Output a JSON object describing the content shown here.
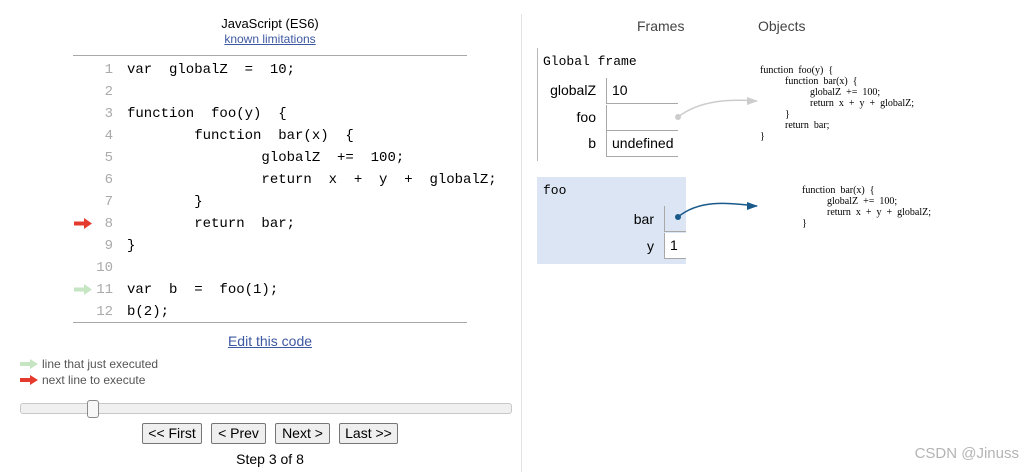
{
  "header": {
    "lang": "JavaScript (ES6)",
    "limitations_link": "known limitations"
  },
  "code": {
    "lines": [
      {
        "num": "1",
        "text": "var  globalZ  =  10;"
      },
      {
        "num": "2",
        "text": ""
      },
      {
        "num": "3",
        "text": "function  foo(y)  {"
      },
      {
        "num": "4",
        "text": "        function  bar(x)  {"
      },
      {
        "num": "5",
        "text": "                globalZ  +=  100;"
      },
      {
        "num": "6",
        "text": "                return  x  +  y  +  globalZ;"
      },
      {
        "num": "7",
        "text": "        }"
      },
      {
        "num": "8",
        "text": "        return  bar;"
      },
      {
        "num": "9",
        "text": "}"
      },
      {
        "num": "10",
        "text": ""
      },
      {
        "num": "11",
        "text": "var  b  =  foo(1);"
      },
      {
        "num": "12",
        "text": "b(2);"
      }
    ],
    "next_line": "8",
    "prev_line": "11"
  },
  "edit_link": "Edit this code",
  "legend": {
    "just_executed": "line that just executed",
    "next_to_execute": "next line to execute"
  },
  "nav": {
    "first": "<< First",
    "prev": "< Prev",
    "next": "Next >",
    "last": "Last >>",
    "step_text": "Step 3 of 8",
    "current_step": 3,
    "total_steps": 8
  },
  "viz": {
    "frames_header": "Frames",
    "objects_header": "Objects",
    "global_frame": {
      "title": "Global frame",
      "vars": [
        {
          "name": "globalZ",
          "value": "10"
        },
        {
          "name": "foo",
          "value": ""
        },
        {
          "name": "b",
          "value": "undefined"
        }
      ]
    },
    "foo_frame": {
      "title": "foo",
      "vars": [
        {
          "name": "bar",
          "value": ""
        },
        {
          "name": "y",
          "value": "1"
        }
      ]
    },
    "objects": {
      "foo_code": "function  foo(y)  {\n          function  bar(x)  {\n                    globalZ  +=  100;\n                    return  x  +  y  +  globalZ;\n          }\n          return  bar;\n}",
      "bar_code": "function  bar(x)  {\n          globalZ  +=  100;\n          return  x  +  y  +  globalZ;\n}"
    }
  },
  "colors": {
    "next_arrow": "#e53b2e",
    "prev_arrow": "#c5e5c3",
    "link": "#3d58a2",
    "frame_highlight": "#dbe5f3",
    "pointer_active": "#1a5a8a",
    "pointer_inactive": "#cccccc"
  },
  "watermark": "CSDN @Jinuss"
}
